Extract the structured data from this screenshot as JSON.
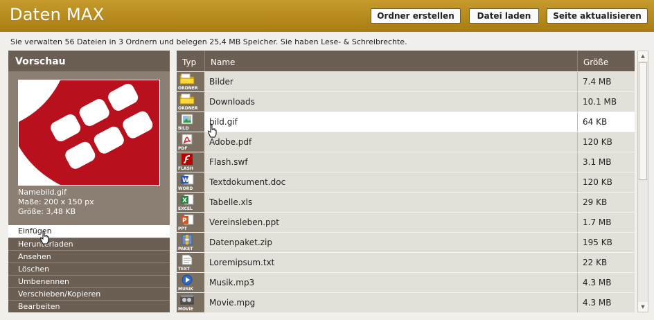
{
  "app": {
    "title": "Daten MAX"
  },
  "toolbar": {
    "create_folder": "Ordner erstellen",
    "upload_file": "Datei laden",
    "refresh": "Seite aktualisieren"
  },
  "status_text": "Sie verwalten 56 Dateien in 3 Ordnern und belegen 25,4 MB Speicher. Sie haben Lese- & Schreibrechte.",
  "preview": {
    "title": "Vorschau",
    "filename": "Namebild.gif",
    "dimensions": "Maße: 200 x 150 px",
    "size": "Größe: 3,48 KB"
  },
  "actions": [
    {
      "label": "Einfügen",
      "active": true
    },
    {
      "label": "Herunterladen",
      "active": false
    },
    {
      "label": "Ansehen",
      "active": false
    },
    {
      "label": "Löschen",
      "active": false
    },
    {
      "label": "Umbenennen",
      "active": false
    },
    {
      "label": "Verschieben/Kopieren",
      "active": false
    },
    {
      "label": "Bearbeiten",
      "active": false
    }
  ],
  "table": {
    "columns": {
      "type": "Typ",
      "name": "Name",
      "size": "Größe"
    },
    "rows": [
      {
        "type": "ORDNER",
        "icon": "folder-icon",
        "name": "Bilder",
        "size": "7.4 MB"
      },
      {
        "type": "ORDNER",
        "icon": "folder-icon",
        "name": "Downloads",
        "size": "10.1 MB"
      },
      {
        "type": "BILD",
        "icon": "image-icon",
        "name": "bild.gif",
        "size": "64 KB",
        "highlight": true
      },
      {
        "type": "PDF",
        "icon": "pdf-icon",
        "name": "Adobe.pdf",
        "size": "120 KB"
      },
      {
        "type": "FLASH",
        "icon": "flash-icon",
        "name": "Flash.swf",
        "size": "3.1 MB"
      },
      {
        "type": "WORD",
        "icon": "word-icon",
        "name": "Textdokument.doc",
        "size": "120 KB"
      },
      {
        "type": "EXCEL",
        "icon": "excel-icon",
        "name": "Tabelle.xls",
        "size": "29 KB"
      },
      {
        "type": "PPT",
        "icon": "powerpoint-icon",
        "name": "Vereinsleben.ppt",
        "size": "1.7 MB"
      },
      {
        "type": "PAKET",
        "icon": "archive-icon",
        "name": "Datenpaket.zip",
        "size": "195 KB"
      },
      {
        "type": "TEXT",
        "icon": "text-file-icon",
        "name": "Loremipsum.txt",
        "size": "22 KB"
      },
      {
        "type": "MUSIK",
        "icon": "music-icon",
        "name": "Musik.mp3",
        "size": "4.3 MB"
      },
      {
        "type": "MOVIE",
        "icon": "movie-icon",
        "name": "Movie.mpg",
        "size": "4.3 MB"
      }
    ]
  },
  "colors": {
    "header": "#b38a1e",
    "panel": "#6b5e52",
    "row": "#e3e0da",
    "row_highlight": "#ffffff"
  }
}
